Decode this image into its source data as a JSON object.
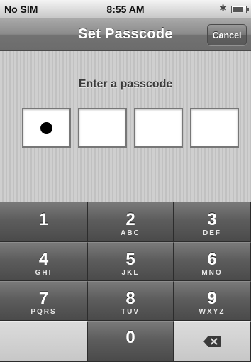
{
  "status_bar": {
    "carrier": "No SIM",
    "time": "8:55 AM",
    "bluetooth_icon": "bluetooth-icon",
    "battery_icon": "battery-icon",
    "battery_level": 0.85
  },
  "nav_bar": {
    "title": "Set Passcode",
    "cancel_label": "Cancel"
  },
  "passcode": {
    "prompt": "Enter a passcode",
    "length": 4,
    "entered_count": 1
  },
  "keypad": {
    "keys": [
      {
        "num": "1",
        "letters": ""
      },
      {
        "num": "2",
        "letters": "ABC"
      },
      {
        "num": "3",
        "letters": "DEF"
      },
      {
        "num": "4",
        "letters": "GHI"
      },
      {
        "num": "5",
        "letters": "JKL"
      },
      {
        "num": "6",
        "letters": "MNO"
      },
      {
        "num": "7",
        "letters": "PQRS"
      },
      {
        "num": "8",
        "letters": "TUV"
      },
      {
        "num": "9",
        "letters": "WXYZ"
      }
    ],
    "zero": "0",
    "delete_icon": "backspace-icon"
  },
  "colors": {
    "nav_bar": "#7f7f7f",
    "key_dark": "#5d5d5d",
    "key_light": "#cfcfcf",
    "text_light": "#ffffff"
  }
}
